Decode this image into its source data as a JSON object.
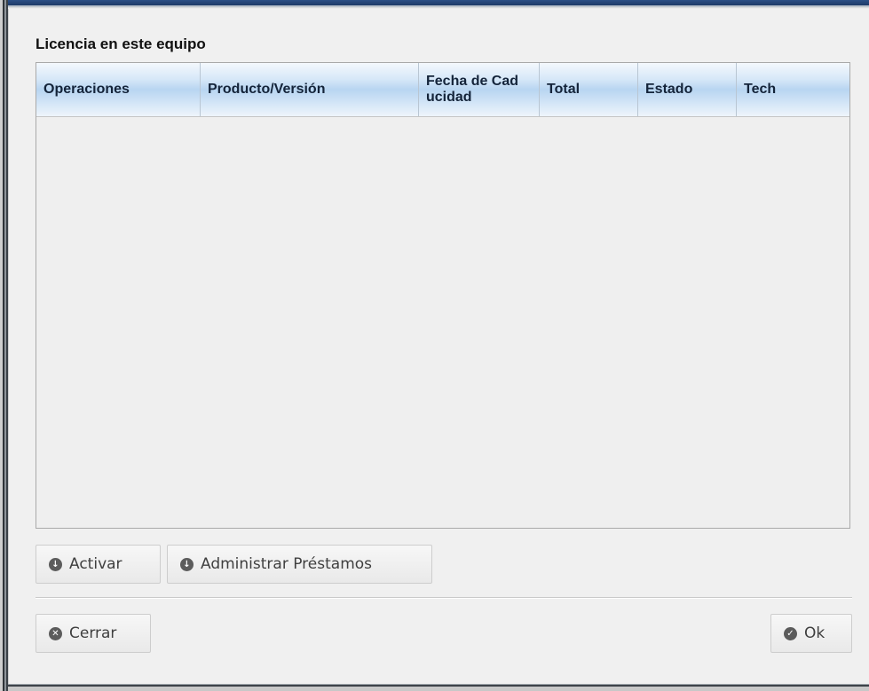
{
  "section": {
    "title": "Licencia en este equipo"
  },
  "table": {
    "columns": [
      {
        "label": "Operaciones"
      },
      {
        "label": "Producto/Versión"
      },
      {
        "label": "Fecha de Cad\nucidad"
      },
      {
        "label": "Total"
      },
      {
        "label": "Estado"
      },
      {
        "label": "Tech"
      }
    ],
    "rows": []
  },
  "actions": {
    "activar_label": "Activar",
    "administrar_label": "Administrar Préstamos"
  },
  "footer": {
    "cerrar_label": "Cerrar",
    "ok_label": "Ok"
  },
  "icons": {
    "activar": "download-circle-icon",
    "administrar": "download-circle-icon",
    "cerrar": "close-circle-icon",
    "ok": "check-circle-icon"
  }
}
